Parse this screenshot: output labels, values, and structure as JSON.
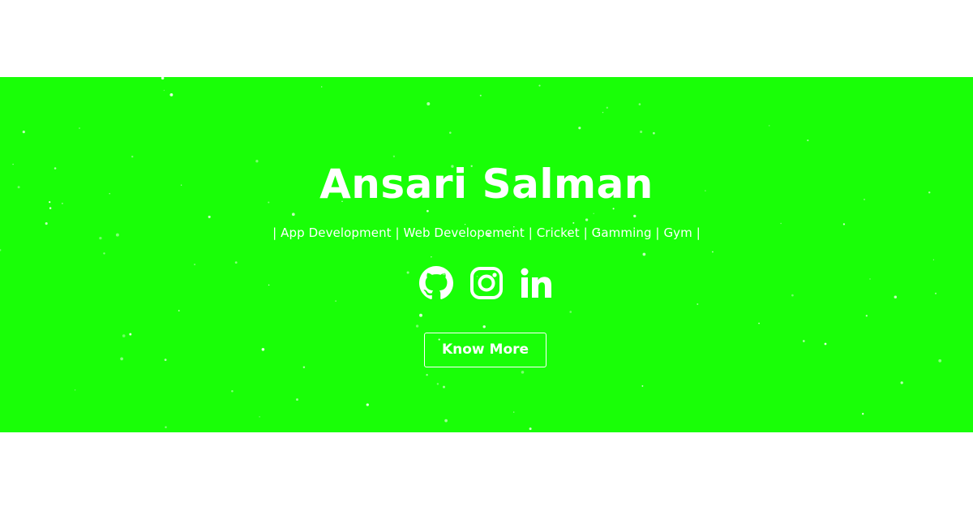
{
  "hero": {
    "background_color": "#19ff07",
    "text_color": "#ffffff",
    "name": "Ansari Salman",
    "tagline": "| App Development | Web Developement | Cricket | Gamming | Gym |",
    "socials": [
      {
        "icon": "github-icon",
        "label": "GitHub"
      },
      {
        "icon": "instagram-icon",
        "label": "Instagram"
      },
      {
        "icon": "linkedin-icon",
        "label": "LinkedIn"
      }
    ],
    "cta_label": "Know More"
  }
}
